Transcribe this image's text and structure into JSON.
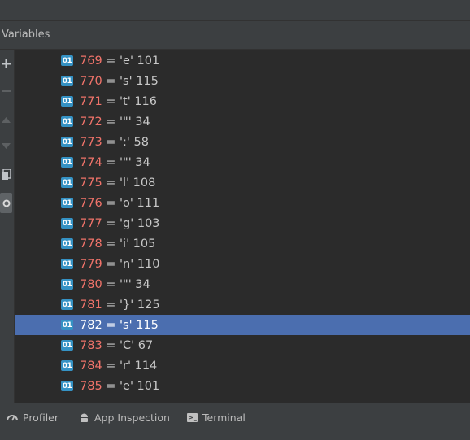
{
  "panel": {
    "title": "Variables"
  },
  "toolbar": {
    "icons": [
      "add-icon",
      "remove-icon",
      "move-up-icon",
      "move-down-icon",
      "copy-icon",
      "watch-icon"
    ]
  },
  "variables": [
    {
      "index": "769",
      "value": "= 'e' 101"
    },
    {
      "index": "770",
      "value": "= 's' 115"
    },
    {
      "index": "771",
      "value": "= 't' 116"
    },
    {
      "index": "772",
      "value": "= '\"' 34"
    },
    {
      "index": "773",
      "value": "= ':' 58"
    },
    {
      "index": "774",
      "value": "= '\"' 34"
    },
    {
      "index": "775",
      "value": "= 'l' 108"
    },
    {
      "index": "776",
      "value": "= 'o' 111"
    },
    {
      "index": "777",
      "value": "= 'g' 103"
    },
    {
      "index": "778",
      "value": "= 'i' 105"
    },
    {
      "index": "779",
      "value": "= 'n' 110"
    },
    {
      "index": "780",
      "value": "= '\"' 34"
    },
    {
      "index": "781",
      "value": "= '}' 125"
    },
    {
      "index": "782",
      "value": "= 's' 115",
      "selected": true
    },
    {
      "index": "783",
      "value": "= 'C' 67"
    },
    {
      "index": "784",
      "value": "= 'r' 114"
    },
    {
      "index": "785",
      "value": "= 'e' 101"
    }
  ],
  "badge_label": "01",
  "bottom_tabs": {
    "profiler": "Profiler",
    "app_inspection": "App Inspection",
    "terminal": "Terminal"
  },
  "colors": {
    "index": "#f0736a",
    "selection": "#4b6eaf",
    "badge": "#3592c4"
  }
}
